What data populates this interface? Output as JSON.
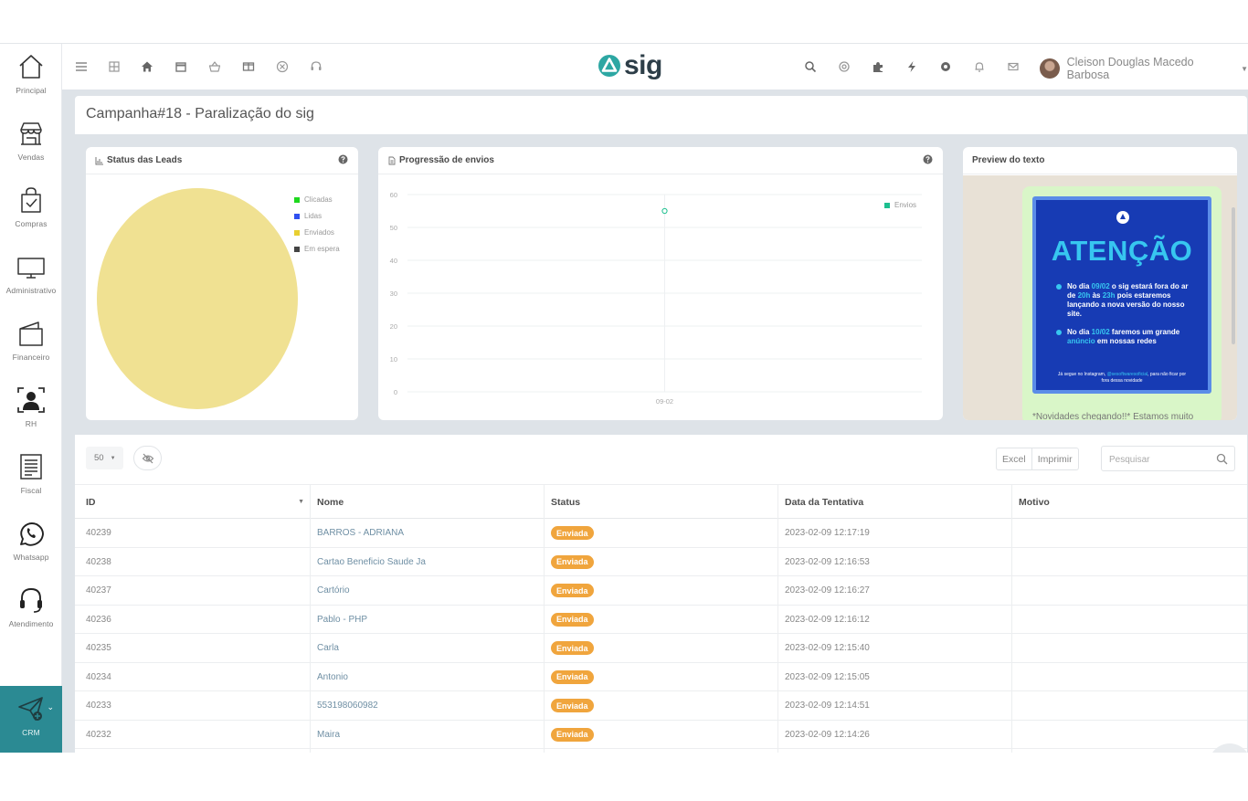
{
  "sidebar": {
    "items": [
      {
        "label": "Principal",
        "icon": "home-outline-icon"
      },
      {
        "label": "Vendas",
        "icon": "storefront-icon"
      },
      {
        "label": "Compras",
        "icon": "shopping-bag-check-icon"
      },
      {
        "label": "Administrativo",
        "icon": "monitor-icon"
      },
      {
        "label": "Financeiro",
        "icon": "wallet-icon"
      },
      {
        "label": "RH",
        "icon": "person-badge-icon"
      },
      {
        "label": "Fiscal",
        "icon": "receipt-icon"
      },
      {
        "label": "Whatsapp",
        "icon": "whatsapp-icon"
      },
      {
        "label": "Atendimento",
        "icon": "headset-icon"
      },
      {
        "label": "CRM",
        "icon": "send-plus-icon",
        "active": true
      }
    ]
  },
  "topbar": {
    "logo_text": "sig",
    "user_name": "Cleison Douglas Macedo Barbosa"
  },
  "page": {
    "title": "Campanha#18 - Paralização do sig"
  },
  "cards": {
    "status": {
      "title": "Status das Leads",
      "legend": [
        {
          "label": "Clicadas",
          "color": "#1ed81e"
        },
        {
          "label": "Lidas",
          "color": "#3050f0"
        },
        {
          "label": "Enviados",
          "color": "#e8cf30"
        },
        {
          "label": "Em espera",
          "color": "#444444"
        }
      ],
      "pie_color": "#f0e192"
    },
    "progress": {
      "title": "Progressão de envios",
      "legend_label": "Envios",
      "series_color": "#1dbf8f"
    },
    "preview": {
      "title": "Preview do texto",
      "poster_title": "ATENÇÃO",
      "p1_a": "No dia ",
      "p1_date": "09/02",
      "p1_b": " o sig estará fora do ar de ",
      "p1_from": "20h",
      "p1_c": " às ",
      "p1_to": "23h",
      "p1_d": " pois estaremos lançando a nova versão do nosso site.",
      "p2_a": "No dia ",
      "p2_date": "10/02",
      "p2_b": " faremos um grande ",
      "p2_hl": "anúncio",
      "p2_c": " em nossas redes",
      "foot_a": "Já segue no Instagram, ",
      "foot_handle": "@sesoftwaresoficial",
      "foot_b": ", para não ficar por fora dessa novidade",
      "message": "*Novidades chegando!!* Estamos muito"
    }
  },
  "chart_data": {
    "type": "line",
    "x": [
      "09-02"
    ],
    "series": [
      {
        "name": "Envios",
        "values": [
          55
        ]
      }
    ],
    "ylim": [
      0,
      60
    ],
    "yticks": [
      0,
      10,
      20,
      30,
      40,
      50,
      60
    ],
    "legend": "top-right",
    "grid": true
  },
  "table": {
    "page_length": "50",
    "buttons": {
      "excel": "Excel",
      "print": "Imprimir"
    },
    "search_placeholder": "Pesquisar",
    "columns": [
      "ID",
      "Nome",
      "Status",
      "Data da Tentativa",
      "Motivo"
    ],
    "rows": [
      {
        "id": "40239",
        "name": "BARROS - ADRIANA",
        "status": "Enviada",
        "date": "2023-02-09 12:17:19",
        "reason": ""
      },
      {
        "id": "40238",
        "name": "Cartao Beneficio Saude Ja",
        "status": "Enviada",
        "date": "2023-02-09 12:16:53",
        "reason": ""
      },
      {
        "id": "40237",
        "name": "Cartório",
        "status": "Enviada",
        "date": "2023-02-09 12:16:27",
        "reason": ""
      },
      {
        "id": "40236",
        "name": "Pablo - PHP",
        "status": "Enviada",
        "date": "2023-02-09 12:16:12",
        "reason": ""
      },
      {
        "id": "40235",
        "name": "Carla",
        "status": "Enviada",
        "date": "2023-02-09 12:15:40",
        "reason": ""
      },
      {
        "id": "40234",
        "name": "Antonio",
        "status": "Enviada",
        "date": "2023-02-09 12:15:05",
        "reason": ""
      },
      {
        "id": "40233",
        "name": "553198060982",
        "status": "Enviada",
        "date": "2023-02-09 12:14:51",
        "reason": ""
      },
      {
        "id": "40232",
        "name": "Maira",
        "status": "Enviada",
        "date": "2023-02-09 12:14:26",
        "reason": ""
      }
    ]
  },
  "colors": {
    "accent": "#2b8a93",
    "badge": "#f0a53d",
    "link": "#6f8fa4"
  }
}
